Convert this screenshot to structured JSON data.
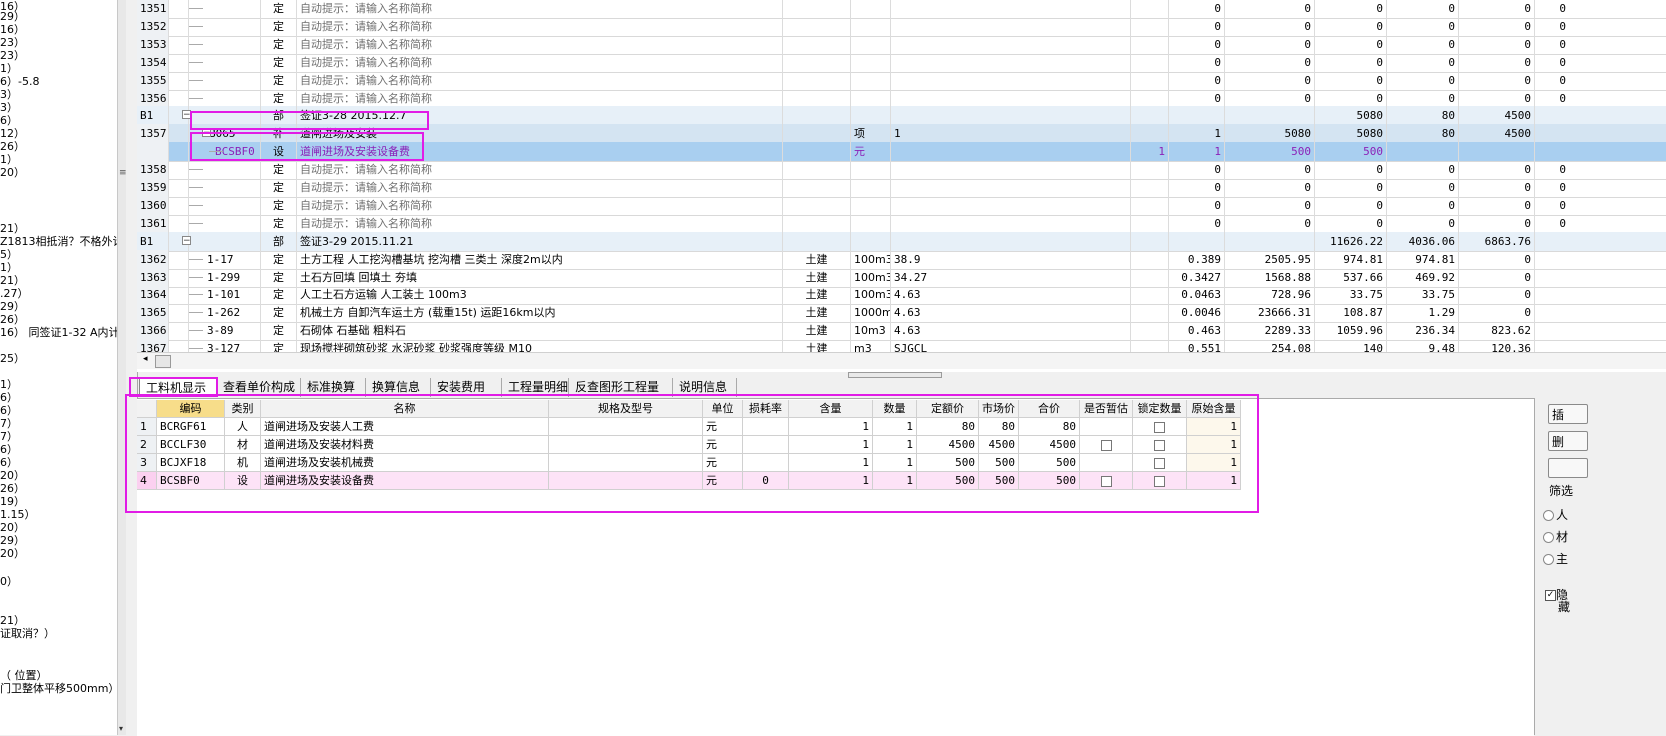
{
  "left_panel": {
    "lines": [
      "16）",
      "29）",
      "16）",
      "23）",
      "23）",
      "1）",
      "6）-5.8",
      "3）",
      "3）",
      "6）",
      "12）",
      "26）",
      "1）",
      "20）",
      "21）",
      "Z1813相抵消？不格外计",
      "5）",
      "1）",
      "21）",
      ".27）",
      "29）",
      "26）",
      "16） 同签证1-32 A内计",
      "25）",
      "1）",
      "6）",
      "6）",
      "7）",
      "7）",
      "6）",
      "6）",
      "20）",
      "26）",
      "19）",
      "1.15）",
      "20）",
      "29）",
      "20）",
      "0）",
      "21）",
      "证取消？）",
      "（ 位置）",
      "门卫整体平移500mm）"
    ]
  },
  "upper_grid": {
    "rows": [
      {
        "no": "1351",
        "code": "",
        "type": "定",
        "name": "自动提示：请输入名称简称",
        "gray": true,
        "qa": "",
        "qb": "0",
        "price": "0",
        "total": "0",
        "v1": "0",
        "v2": "0",
        "v3": "0"
      },
      {
        "no": "1352",
        "code": "",
        "type": "定",
        "name": "自动提示：请输入名称简称",
        "gray": true,
        "qa": "",
        "qb": "0",
        "price": "0",
        "total": "0",
        "v1": "0",
        "v2": "0",
        "v3": "0"
      },
      {
        "no": "1353",
        "code": "",
        "type": "定",
        "name": "自动提示：请输入名称简称",
        "gray": true,
        "qa": "",
        "qb": "0",
        "price": "0",
        "total": "0",
        "v1": "0",
        "v2": "0",
        "v3": "0"
      },
      {
        "no": "1354",
        "code": "",
        "type": "定",
        "name": "自动提示：请输入名称简称",
        "gray": true,
        "qa": "",
        "qb": "0",
        "price": "0",
        "total": "0",
        "v1": "0",
        "v2": "0",
        "v3": "0"
      },
      {
        "no": "1355",
        "code": "",
        "type": "定",
        "name": "自动提示：请输入名称简称",
        "gray": true,
        "qa": "",
        "qb": "0",
        "price": "0",
        "total": "0",
        "v1": "0",
        "v2": "0",
        "v3": "0"
      },
      {
        "no": "1356",
        "code": "",
        "type": "定",
        "name": "自动提示：请输入名称简称",
        "gray": true,
        "qa": "",
        "qb": "0",
        "price": "0",
        "total": "0",
        "v1": "0",
        "v2": "0",
        "v3": "0"
      },
      {
        "no": "B1",
        "code": "",
        "type": "部",
        "name": "签证3-28  2015.12.7",
        "section": true,
        "qa": "",
        "qb": "",
        "price": "",
        "total": "5080",
        "v1": "80",
        "v2": "4500",
        "v3": ""
      },
      {
        "no": "1357",
        "code": "B065",
        "type": "补",
        "name": "道闸进场及安装",
        "sel": true,
        "spec": "",
        "unit": "项",
        "qexpr": "1",
        "qa": "",
        "qb": "1",
        "price": "5080",
        "total": "5080",
        "v1": "80",
        "v2": "4500",
        "v3": ""
      },
      {
        "no": "",
        "code": "BCSBF0",
        "type": "设",
        "name": "道闸进场及安装设备费",
        "hl": true,
        "purple": true,
        "unit": "元",
        "qexpr": "",
        "qa": "1",
        "qb": "1",
        "price": "500",
        "total": "500",
        "v1": "",
        "v2": "",
        "v3": ""
      },
      {
        "no": "1358",
        "code": "",
        "type": "定",
        "name": "自动提示：请输入名称简称",
        "gray": true,
        "qa": "",
        "qb": "0",
        "price": "0",
        "total": "0",
        "v1": "0",
        "v2": "0",
        "v3": "0"
      },
      {
        "no": "1359",
        "code": "",
        "type": "定",
        "name": "自动提示：请输入名称简称",
        "gray": true,
        "qa": "",
        "qb": "0",
        "price": "0",
        "total": "0",
        "v1": "0",
        "v2": "0",
        "v3": "0"
      },
      {
        "no": "1360",
        "code": "",
        "type": "定",
        "name": "自动提示：请输入名称简称",
        "gray": true,
        "qa": "",
        "qb": "0",
        "price": "0",
        "total": "0",
        "v1": "0",
        "v2": "0",
        "v3": "0"
      },
      {
        "no": "1361",
        "code": "",
        "type": "定",
        "name": "自动提示：请输入名称简称",
        "gray": true,
        "qa": "",
        "qb": "0",
        "price": "0",
        "total": "0",
        "v1": "0",
        "v2": "0",
        "v3": "0"
      },
      {
        "no": "B1",
        "code": "",
        "type": "部",
        "name": "签证3-29  2015.11.21",
        "section": true,
        "qa": "",
        "qb": "",
        "price": "",
        "total": "11626.22",
        "v1": "4036.06",
        "v2": "6863.76",
        "v3": ""
      },
      {
        "no": "1362",
        "code": "1-17",
        "type": "定",
        "name": "土方工程 人工挖沟槽基坑 挖沟槽 三类土 深度2m以内",
        "spec": "土建",
        "unit": "100m3",
        "qexpr": "38.9",
        "qa": "",
        "qb": "0.389",
        "price": "2505.95",
        "total": "974.81",
        "v1": "974.81",
        "v2": "0",
        "v3": ""
      },
      {
        "no": "1363",
        "code": "1-299",
        "type": "定",
        "name": "土石方回填 回填土 夯填",
        "spec": "土建",
        "unit": "100m3",
        "qexpr": "34.27",
        "qa": "",
        "qb": "0.3427",
        "price": "1568.88",
        "total": "537.66",
        "v1": "469.92",
        "v2": "0",
        "v3": ""
      },
      {
        "no": "1364",
        "code": "1-101",
        "type": "定",
        "name": "人工土石方运输 人工装土 100m3",
        "spec": "土建",
        "unit": "100m3",
        "qexpr": "4.63",
        "qa": "",
        "qb": "0.0463",
        "price": "728.96",
        "total": "33.75",
        "v1": "33.75",
        "v2": "0",
        "v3": ""
      },
      {
        "no": "1365",
        "code": "1-262",
        "type": "定",
        "name": "机械土方 自卸汽车运土方 (载重15t) 运距16km以内",
        "spec": "土建",
        "unit": "1000m3",
        "qexpr": "4.63",
        "qa": "",
        "qb": "0.0046",
        "price": "23666.31",
        "total": "108.87",
        "v1": "1.29",
        "v2": "0",
        "v3": ""
      },
      {
        "no": "1366",
        "code": "3-89",
        "type": "定",
        "name": "石砌体 石基础 粗料石",
        "spec": "土建",
        "unit": "10m3",
        "qexpr": "4.63",
        "qa": "",
        "qb": "0.463",
        "price": "2289.33",
        "total": "1059.96",
        "v1": "236.34",
        "v2": "823.62",
        "v3": ""
      },
      {
        "no": "1367",
        "code": "3-127",
        "type": "定",
        "name": "现场搅拌砌筑砂浆 水泥砂浆 砂浆强度等级 M10",
        "spec": "土建",
        "unit": "m3",
        "qexpr": "SJGCL",
        "qa": "",
        "qb": "0.551",
        "price": "254.08",
        "total": "140",
        "v1": "9.48",
        "v2": "120.36",
        "v3": ""
      }
    ]
  },
  "scroll_arrows": {
    "left": "◂",
    "down": "▾",
    "grip": "≡"
  },
  "tabs": [
    "工料机显示",
    "查看单价构成",
    "标准换算",
    "换算信息",
    "安装费用",
    "工程量明细",
    "反查图形工程量",
    "说明信息"
  ],
  "lower_grid": {
    "headers": {
      "code": "编码",
      "type": "类别",
      "name": "名称",
      "spec": "规格及型号",
      "unit": "单位",
      "loss": "损耗率",
      "qty": "含量",
      "num": "数量",
      "quota": "定额价",
      "mkt": "市场价",
      "sum": "合价",
      "est": "是否暂估",
      "lock": "锁定数量",
      "orig": "原始含量"
    },
    "rows": [
      {
        "idx": "1",
        "code": "BCRGF61",
        "type": "人",
        "name": "道闸进场及安装人工费",
        "spec": "",
        "unit": "元",
        "loss": "",
        "qty": "1",
        "num": "1",
        "quota": "80",
        "mkt": "80",
        "sum": "80",
        "est": false,
        "lock": true,
        "orig": "1"
      },
      {
        "idx": "2",
        "code": "BCCLF30",
        "type": "材",
        "name": "道闸进场及安装材料费",
        "spec": "",
        "unit": "元",
        "loss": "",
        "qty": "1",
        "num": "1",
        "quota": "4500",
        "mkt": "4500",
        "sum": "4500",
        "est": true,
        "lock": true,
        "orig": "1"
      },
      {
        "idx": "3",
        "code": "BCJXF18",
        "type": "机",
        "name": "道闸进场及安装机械费",
        "spec": "",
        "unit": "元",
        "loss": "",
        "qty": "1",
        "num": "1",
        "quota": "500",
        "mkt": "500",
        "sum": "500",
        "est": false,
        "lock": true,
        "orig": "1"
      },
      {
        "idx": "4",
        "code": "BCSBF0",
        "type": "设",
        "name": "道闸进场及安装设备费",
        "spec": "",
        "unit": "元",
        "loss": "0",
        "qty": "1",
        "num": "1",
        "quota": "500",
        "mkt": "500",
        "sum": "500",
        "est": true,
        "lock": true,
        "orig": "1",
        "pink": true
      }
    ]
  },
  "right_panel": {
    "buttons": [
      "插",
      "删",
      ""
    ],
    "filter_label": "筛选",
    "radios": [
      "人",
      "材",
      "主"
    ],
    "checkbox_label": "隐",
    "checkbox_label2": "藏"
  },
  "colors": {
    "annotation": "#e11ce6",
    "selected_row": "#a9cff0",
    "section_row": "#e7f0f8",
    "pink_row": "#fde3f7",
    "purple_text": "#8b21b8"
  }
}
